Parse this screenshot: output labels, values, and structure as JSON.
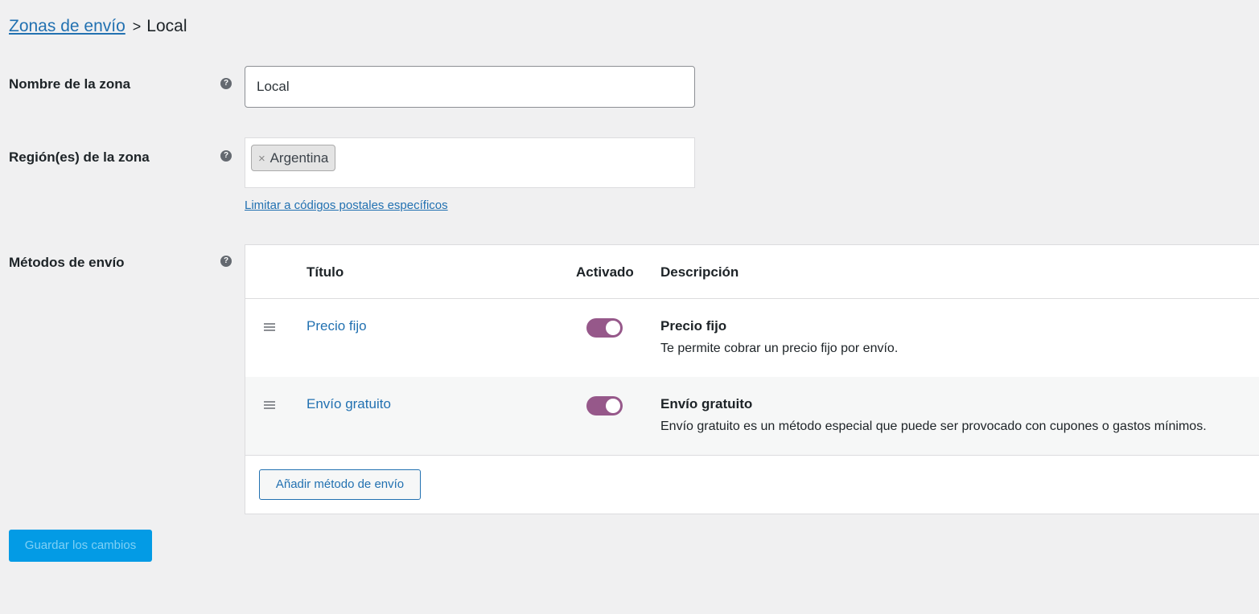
{
  "breadcrumb": {
    "parent": "Zonas de envío",
    "separator": ">",
    "current": "Local"
  },
  "zone_name": {
    "label": "Nombre de la zona",
    "value": "Local"
  },
  "zone_regions": {
    "label": "Región(es) de la zona",
    "chips": [
      {
        "remove": "×",
        "label": "Argentina"
      }
    ],
    "postcode_link": "Limitar a códigos postales específicos"
  },
  "shipping_methods": {
    "label": "Métodos de envío",
    "columns": {
      "title": "Título",
      "enabled": "Activado",
      "description": "Descripción"
    },
    "rows": [
      {
        "title": "Precio fijo",
        "enabled": true,
        "desc_title": "Precio fijo",
        "desc_text": "Te permite cobrar un precio fijo por envío."
      },
      {
        "title": "Envío gratuito",
        "enabled": true,
        "desc_title": "Envío gratuito",
        "desc_text": "Envío gratuito es un método especial que puede ser provocado con cupones o gastos mínimos."
      }
    ],
    "add_button": "Añadir método de envío"
  },
  "help_icon_glyph": "?",
  "save_button": "Guardar los cambios",
  "colors": {
    "link": "#2271b1",
    "toggle_on": "#96588a",
    "save_bg": "#039be5"
  }
}
